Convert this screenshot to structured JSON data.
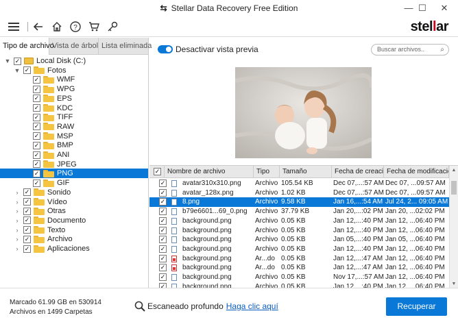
{
  "window": {
    "title": "Stellar Data Recovery Free Edition",
    "minimize": "—",
    "maximize": "☐",
    "close": "✕"
  },
  "toolbar": {
    "icons": [
      "menu-icon",
      "back-icon",
      "home-icon",
      "help-icon",
      "cart-icon",
      "key-icon"
    ],
    "brand_pre": "stel",
    "brand_ll": "l",
    "brand_post": "ar"
  },
  "tabs": [
    "Tipo de archivo",
    "Vista de árbol",
    "Lista eliminada"
  ],
  "tree": {
    "root": "Local Disk (C:)",
    "fotos": "Fotos",
    "fotos_children": [
      "WMF",
      "WPG",
      "EPS",
      "KDC",
      "TIFF",
      "RAW",
      "MSP",
      "BMP",
      "ANI",
      "JPEG",
      "PNG",
      "GIF"
    ],
    "selected": "PNG",
    "other": [
      "Sonido",
      "Vídeo",
      "Otras",
      "Documento",
      "Texto",
      "Archivo",
      "Aplicaciones"
    ]
  },
  "preview": {
    "toggle_label": "Desactivar vista previa",
    "toggle_on": true
  },
  "search": {
    "placeholder": "Buscar archivos.."
  },
  "grid": {
    "columns": [
      "Nombre de archivo",
      "Tipo",
      "Tamaño",
      "Fecha de creación",
      "Fecha de modificación"
    ],
    "rows": [
      {
        "name": "avatar310x310.png",
        "type": "Archivo",
        "size": "105.54 KB",
        "created": "Dec 07,...:57 AM",
        "modified": "Dec 07, ...09:57 AM",
        "icon": "blue"
      },
      {
        "name": "avatar_128x.png",
        "type": "Archivo",
        "size": "1.02 KB",
        "created": "Dec 07,...:57 AM",
        "modified": "Dec 07, ...09:57 AM",
        "icon": "blue"
      },
      {
        "name": "8.png",
        "type": "Archivo",
        "size": "9.58 KB",
        "created": "Jan 16,...:54 AM",
        "modified": "Jul 24, 2... 09:05 AM",
        "icon": "blue",
        "selected": true
      },
      {
        "name": "b79e6601...69_0.png",
        "type": "Archivo",
        "size": "37.79 KB",
        "created": "Jan 20,...:02 PM",
        "modified": "Jan 20, ...02:02 PM",
        "icon": "blue"
      },
      {
        "name": "background.png",
        "type": "Archivo",
        "size": "0.05 KB",
        "created": "Jan 12,...:40 PM",
        "modified": "Jan 12, ...06:40 PM",
        "icon": "blue"
      },
      {
        "name": "background.png",
        "type": "Archivo",
        "size": "0.05 KB",
        "created": "Jan 12,...:40 PM",
        "modified": "Jan 12, ...06:40 PM",
        "icon": "blue"
      },
      {
        "name": "background.png",
        "type": "Archivo",
        "size": "0.05 KB",
        "created": "Jan 05,...:40 PM",
        "modified": "Jan 05, ...06:40 PM",
        "icon": "blue"
      },
      {
        "name": "background.png",
        "type": "Archivo",
        "size": "0.05 KB",
        "created": "Jan 12,...:40 PM",
        "modified": "Jan 12, ...06:40 PM",
        "icon": "blue"
      },
      {
        "name": "background.png",
        "type": "Ar...do",
        "size": "0.05 KB",
        "created": "Jan 12,...:47 AM",
        "modified": "Jan 12, ...06:40 PM",
        "icon": "red"
      },
      {
        "name": "background.png",
        "type": "Ar...do",
        "size": "0.05 KB",
        "created": "Jan 12,...:47 AM",
        "modified": "Jan 12, ...06:40 PM",
        "icon": "red"
      },
      {
        "name": "background.png",
        "type": "Archivo",
        "size": "0.05 KB",
        "created": "Nov 17,...:57 AM",
        "modified": "Jan 12, ...06:40 PM",
        "icon": "blue"
      },
      {
        "name": "background.png",
        "type": "Archivo",
        "size": "0.05 KB",
        "created": "Jan 12,...:40 PM",
        "modified": "Jan 12, ...06:40 PM",
        "icon": "blue"
      }
    ]
  },
  "footer": {
    "marked": "Marcado 61.99 GB en 530914",
    "files": "Archivos en 1499 Carpetas",
    "deep_scan": "Escaneado profundo",
    "deep_link": "Haga clic aquí",
    "recover": "Recuperar"
  }
}
